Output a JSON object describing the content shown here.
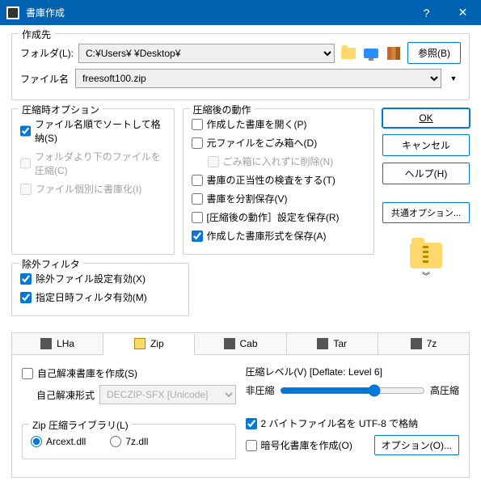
{
  "titlebar": {
    "title": "書庫作成"
  },
  "dest": {
    "legend": "作成先",
    "folder_label": "フォルダ(L):",
    "folder_value": "C:¥Users¥            ¥Desktop¥",
    "filename_label": "ファイル名",
    "filename_value": "freesoft100.zip",
    "browse_label": "参照(B)"
  },
  "compress_opts": {
    "legend": "圧縮時オプション",
    "sort_by_name": "ファイル名順でソートして格納(S)",
    "below_folder": "フォルダより下のファイルを圧縮(C)",
    "per_file": "ファイル個別に書庫化(I)"
  },
  "after_opts": {
    "legend": "圧縮後の動作",
    "open_created": "作成した書庫を開く(P)",
    "to_trash": "元ファイルをごみ箱へ(D)",
    "delete_without_trash": "ごみ箱に入れずに削除(N)",
    "verify": "書庫の正当性の検査をする(T)",
    "split": "書庫を分割保存(V)",
    "save_behavior": "[圧縮後の動作］設定を保存(R)",
    "save_format": "作成した書庫形式を保存(A)"
  },
  "exclude": {
    "legend": "除外フィルタ",
    "enable_filter": "除外ファイル設定有効(X)",
    "date_filter": "指定日時フィルタ有効(M)"
  },
  "buttons": {
    "ok": "OK",
    "cancel": "キャンセル",
    "help": "ヘルプ(H)",
    "common": "共通オプション..."
  },
  "tabs": {
    "lha": "LHa",
    "zip": "Zip",
    "cab": "Cab",
    "tar": "Tar",
    "sevenz": "7z"
  },
  "zip_panel": {
    "sfx": "自己解凍書庫を作成(S)",
    "sfx_format_label": "自己解凍形式",
    "sfx_format_value": "DECZIP-SFX [Unicode]",
    "lib_legend": "Zip 圧縮ライブラリ(L)",
    "lib_arcext": "Arcext.dll",
    "lib_7z": "7z.dll",
    "level_label": "圧縮レベル(V)",
    "level_suffix": "[Deflate: Level 6]",
    "low": "非圧縮",
    "high": "高圧縮",
    "utf8": "2 バイトファイル名を UTF-8 で格納",
    "crypto": "暗号化書庫を作成(O)",
    "option": "オプション(O)..."
  }
}
